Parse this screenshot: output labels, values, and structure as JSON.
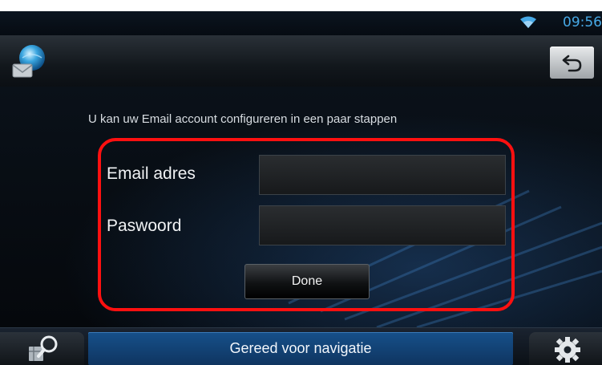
{
  "status_bar": {
    "time": "09:56",
    "wifi_icon": "wifi-icon"
  },
  "header": {
    "app_icon": "email-globe-icon",
    "back_icon": "back-arrow-icon"
  },
  "form": {
    "intro": "U kan uw Email account configureren in een paar stappen",
    "email_label": "Email adres",
    "email_value": "",
    "password_label": "Paswoord",
    "password_value": "",
    "done_label": "Done",
    "highlight_color": "#ff1010"
  },
  "bottom_bar": {
    "nav_status": "Gereed voor navigatie",
    "nav_search_icon": "map-search-icon",
    "settings_icon": "gear-icon",
    "accent_color": "#16508a"
  }
}
